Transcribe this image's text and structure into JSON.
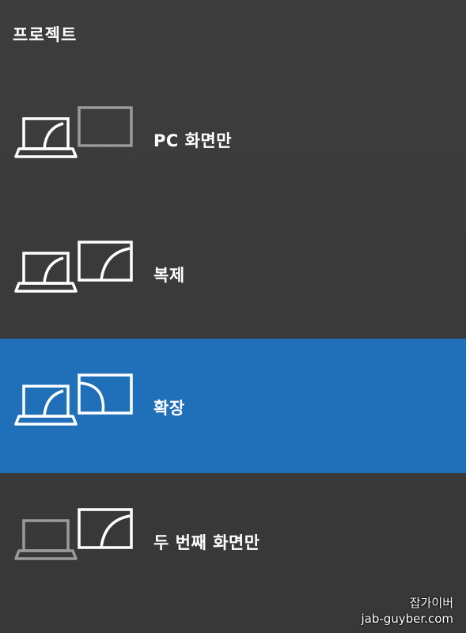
{
  "panel": {
    "title": "프로젝트"
  },
  "options": [
    {
      "label": "PC 화면만",
      "icon": "pc-screen-only-icon",
      "selected": false
    },
    {
      "label": "복제",
      "icon": "duplicate-icon",
      "selected": false
    },
    {
      "label": "확장",
      "icon": "extend-icon",
      "selected": true
    },
    {
      "label": "두 번째 화면만",
      "icon": "second-screen-only-icon",
      "selected": false
    }
  ],
  "watermark": {
    "line1": "잡가이버",
    "line2": "jab-guyber.com"
  },
  "colors": {
    "background": "#3a3a3a",
    "selected": "#1f6fb9",
    "active_outline": "#ffffff",
    "inactive_outline": "#9a9a9a"
  }
}
